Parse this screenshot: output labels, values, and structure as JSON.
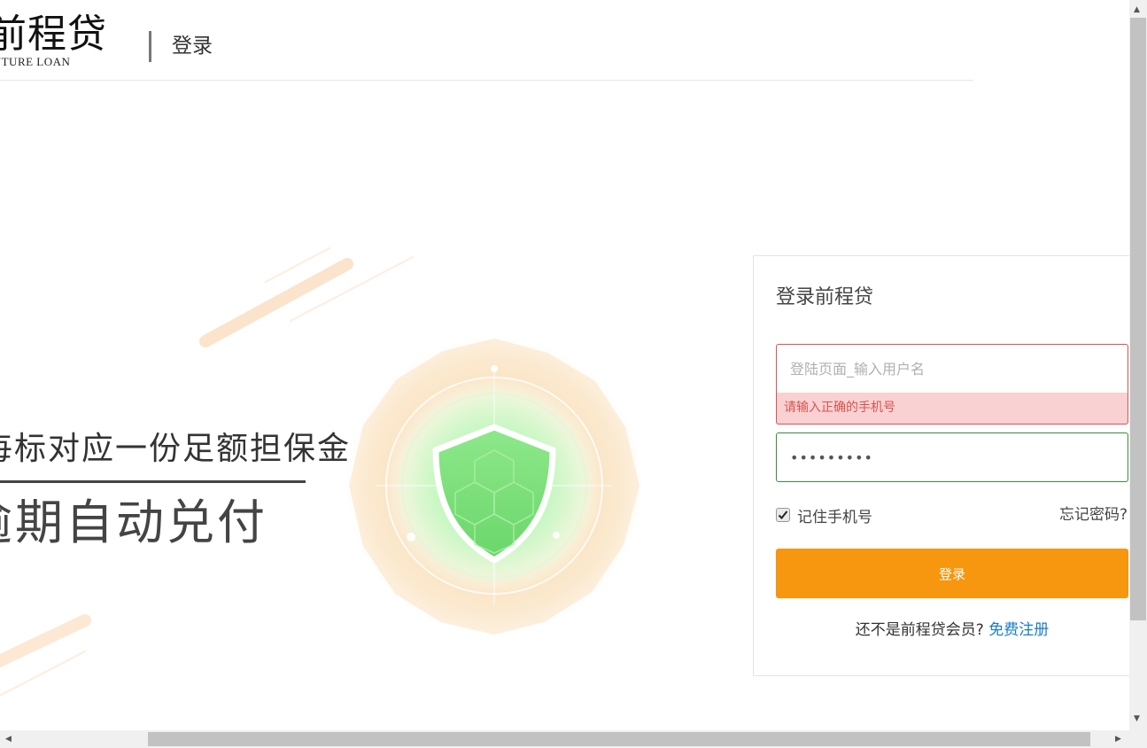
{
  "header": {
    "logo_text": "前程贷",
    "logo_subtext": "FUTURE LOAN",
    "title": "登录"
  },
  "banner": {
    "slogan_line1": "每标对应一份足额担保金",
    "slogan_line2": "逾期自动兑付",
    "shield_icon": "shield-icon"
  },
  "login": {
    "title": "登录前程贷",
    "username_placeholder": "登陆页面_输入用户名",
    "username_error": "请输入正确的手机号",
    "password_value": "123456789",
    "remember_label": "记住手机号",
    "remember_checked": true,
    "forgot_label": "忘记密码?",
    "submit_label": "登录",
    "register_prompt": "还不是前程贷会员?",
    "register_link": "免费注册"
  },
  "colors": {
    "accent": "#f7960f",
    "error": "#d9534f",
    "link": "#1a7bc9",
    "shield_green": "#7ee07e"
  }
}
